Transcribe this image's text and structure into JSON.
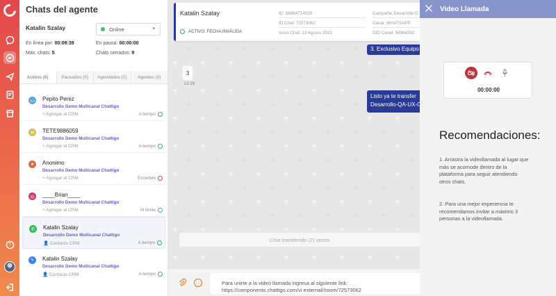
{
  "rail": {
    "icons": [
      "chattigo-logo",
      "chat-bubble-icon",
      "chat-active-icon",
      "send-icon",
      "report-icon",
      "store-icon"
    ],
    "help": "?",
    "accent": "#e2484b"
  },
  "panel": {
    "title": "Chats del agente",
    "agent_name": "Katalin Szalay",
    "status": "Online",
    "stats": {
      "online_label": "En línea por:",
      "online_value": "00:09:39",
      "pause_label": "En pausa:",
      "pause_value": "00:00:00",
      "max_label": "Máx. chats:",
      "max_value": "5",
      "closed_label": "Chats cerrados:",
      "closed_value": "9"
    },
    "tabs": [
      "Activos (6)",
      "Pausados (0)",
      "Agendados (0)",
      "Agentes (0)"
    ],
    "chats": [
      {
        "name": "Pepito Perez",
        "sub": "Desarrollo Demo Multicanal Chattigo",
        "crm": "Agregar al CRM",
        "state": "A tiempo",
        "channel": "webchat",
        "color": "#5aa7d8"
      },
      {
        "name": "TETE9886059",
        "sub": "Desarrollo Demo Multicanal Chattigo",
        "crm": "Agregar al CRM",
        "state": "A tiempo",
        "channel": "sms",
        "color": "#e0b84a"
      },
      {
        "name": "Anonimo",
        "sub": "Desarrollo Demo Multicanal Chattigo",
        "crm": "Agregar al CRM",
        "state": "Excedido",
        "channel": "webchat",
        "color": "#e06a3b"
      },
      {
        "name": "____Brian____",
        "sub": "Desarrollo Demo Multicanal Chattigo",
        "crm": "Agregar al CRM",
        "state": "Al límite",
        "channel": "instagram",
        "color": "#d6336c"
      },
      {
        "name": "Katalin Szalay",
        "sub": "Desarrollo Demo Multicanal Chattigo",
        "crm": "Contacto CRM",
        "state": "A tiempo",
        "channel": "whatsapp",
        "color": "#34b75a"
      },
      {
        "name": "Katalin Szalay",
        "sub": "Desarrollo Demo Multicanal Chattigo",
        "crm": "Contacto CRM",
        "state": "A tiempo",
        "channel": "messenger",
        "color": "#3b7ff0"
      }
    ]
  },
  "conversation": {
    "contact_name": "Katalin Szalay",
    "status_text": "ACTIVO: FECHA INVÁLIDA",
    "id": "ID: 56984714029",
    "id_chat": "ID Chat: 72573062",
    "start": "Inicio Chat: 13 Agosto 2021",
    "campaign": "Campaña: Desarrollo D",
    "channel": "Canal: WHATSAPP",
    "did": "DID Canal: 56964282",
    "msg_out_1": "3. Exclusivo Equipo",
    "msg_in": "3",
    "msg_in_time": "12:19",
    "msg_out_2_line1": "Listo ya te transfer",
    "msg_out_2_line2": "Desarrollo-QA-UX-C",
    "transfer_note": "Chat transferido (2) veces",
    "composer_text": "Para unirte a la video llamada ingresa al siguiente link: https://components.chattigo.com/vi external//room/72573062"
  },
  "video": {
    "title": "Video Llamada",
    "timer": "00:00:00",
    "rec_title": "Recomendaciones:",
    "rec_1": "1. Arrastra la videollamada al lugar que más se acomode dentro de la plataforma para seguir atendiendo otros chats.",
    "rec_2": "2. Para una mejor experiencia te recomendamos invitar a máximo 3 personas a la videollamada.",
    "header_color": "#8794cc"
  }
}
